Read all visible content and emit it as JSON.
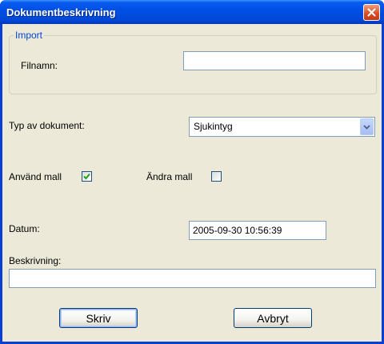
{
  "window": {
    "title": "Dokumentbeskrivning"
  },
  "import_group": {
    "legend": "Import",
    "filename_label": "Filnamn:",
    "filename_value": ""
  },
  "document_type": {
    "label": "Typ av dokument:",
    "selected": "Sjukintyg"
  },
  "template": {
    "use_label": "Använd mall",
    "use_checked": true,
    "edit_label": "Ändra mall",
    "edit_checked": false
  },
  "date": {
    "label": "Datum:",
    "value": "2005-09-30 10:56:39"
  },
  "description": {
    "label": "Beskrivning:",
    "value": ""
  },
  "buttons": {
    "print_label": "Skriv",
    "cancel_label": "Avbryt"
  },
  "colors": {
    "titlebar": "#0050e6",
    "client": "#ece9d8",
    "group_legend": "#0046d5",
    "close_button": "#d9512a"
  }
}
